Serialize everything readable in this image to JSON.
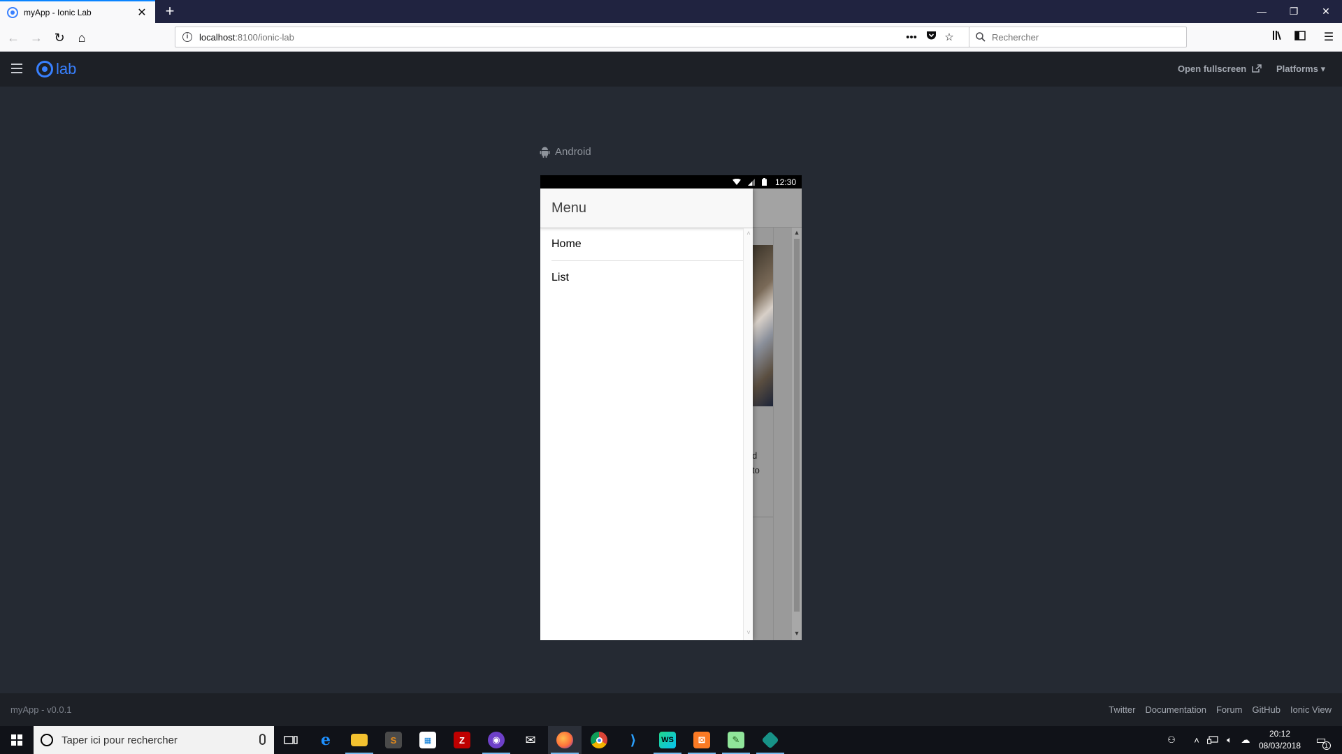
{
  "browser": {
    "tab_title": "myApp - Ionic Lab",
    "tab_close": "✕",
    "new_tab": "+",
    "url_host": "localhost",
    "url_path": ":8100/ionic-lab",
    "search_placeholder": "Rechercher",
    "window_controls": {
      "minimize": "—",
      "restore": "❐",
      "close": "✕"
    }
  },
  "lab": {
    "logo_text": "lab",
    "open_fullscreen": "Open fullscreen",
    "platforms": "Platforms ▾",
    "version": "myApp - v0.0.1",
    "footer_links": [
      "Twitter",
      "Documentation",
      "Forum",
      "GitHub",
      "Ionic View"
    ]
  },
  "device": {
    "platform_label": "Android",
    "status_time": "12:30",
    "menu_title": "Menu",
    "menu_items": [
      "Home",
      "List"
    ],
    "underlying_fragments": [
      "d",
      "to"
    ]
  },
  "taskbar": {
    "search_placeholder": "Taper ici pour rechercher",
    "time": "20:12",
    "date": "08/03/2018",
    "notification_count": "1",
    "apps": [
      {
        "name": "task-view",
        "color": "#101218"
      },
      {
        "name": "edge",
        "color": "#0078d7"
      },
      {
        "name": "file-explorer",
        "color": "#f3c12f"
      },
      {
        "name": "sublime-text",
        "color": "#e38a1b"
      },
      {
        "name": "store",
        "color": "#ffffff"
      },
      {
        "name": "filezilla",
        "color": "#bf0000"
      },
      {
        "name": "github-desktop",
        "color": "#6e40c9"
      },
      {
        "name": "mail",
        "color": "#ffffff"
      },
      {
        "name": "firefox",
        "color": "#ff7139"
      },
      {
        "name": "chrome",
        "color": "#4caf50"
      },
      {
        "name": "vscode",
        "color": "#0078d7"
      },
      {
        "name": "webstorm",
        "color": "#21d789"
      },
      {
        "name": "xampp",
        "color": "#fb7a24"
      },
      {
        "name": "notepad-plus-plus",
        "color": "#90e59a"
      },
      {
        "name": "gitkraken",
        "color": "#179287"
      }
    ]
  },
  "colors": {
    "ionic_blue": "#3880ff",
    "lab_bg": "#252a33",
    "lab_bar": "#1d2026"
  }
}
